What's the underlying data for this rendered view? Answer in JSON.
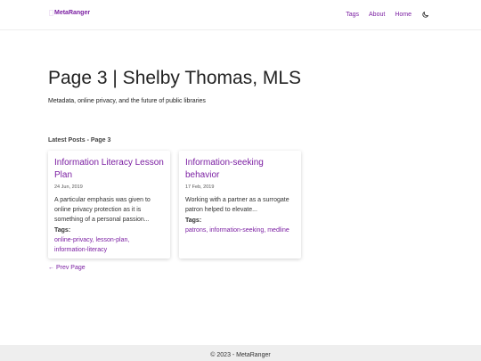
{
  "nav": {
    "brand": "MetaRanger",
    "links": [
      "Tags",
      "About",
      "Home"
    ],
    "theme_icon": "moon-icon"
  },
  "header": {
    "title": "Page 3 | Shelby Thomas, MLS",
    "subtitle": "Metadata, online privacy, and the future of public libraries"
  },
  "section_heading": "Latest Posts - Page 3",
  "posts": [
    {
      "title": "Information Literacy Lesson Plan",
      "date": "24 Jun, 2019",
      "excerpt": "A particular emphasis was given to online privacy protection as it is something of a personal passion...",
      "tags_label": "Tags:",
      "tags": "online-privacy, lesson-plan, information-literacy"
    },
    {
      "title": "Information-seeking behavior",
      "date": "17 Feb, 2019",
      "excerpt": "Working with a partner as a surrogate patron helped to elevate...",
      "tags_label": "Tags:",
      "tags": "patrons, information-seeking, medline"
    }
  ],
  "pagination": {
    "prev": "← Prev Page"
  },
  "footer": {
    "text": "© 2023 - MetaRanger"
  },
  "colors": {
    "accent": "#7b1fa2",
    "footer_bg": "#eeeeee"
  }
}
